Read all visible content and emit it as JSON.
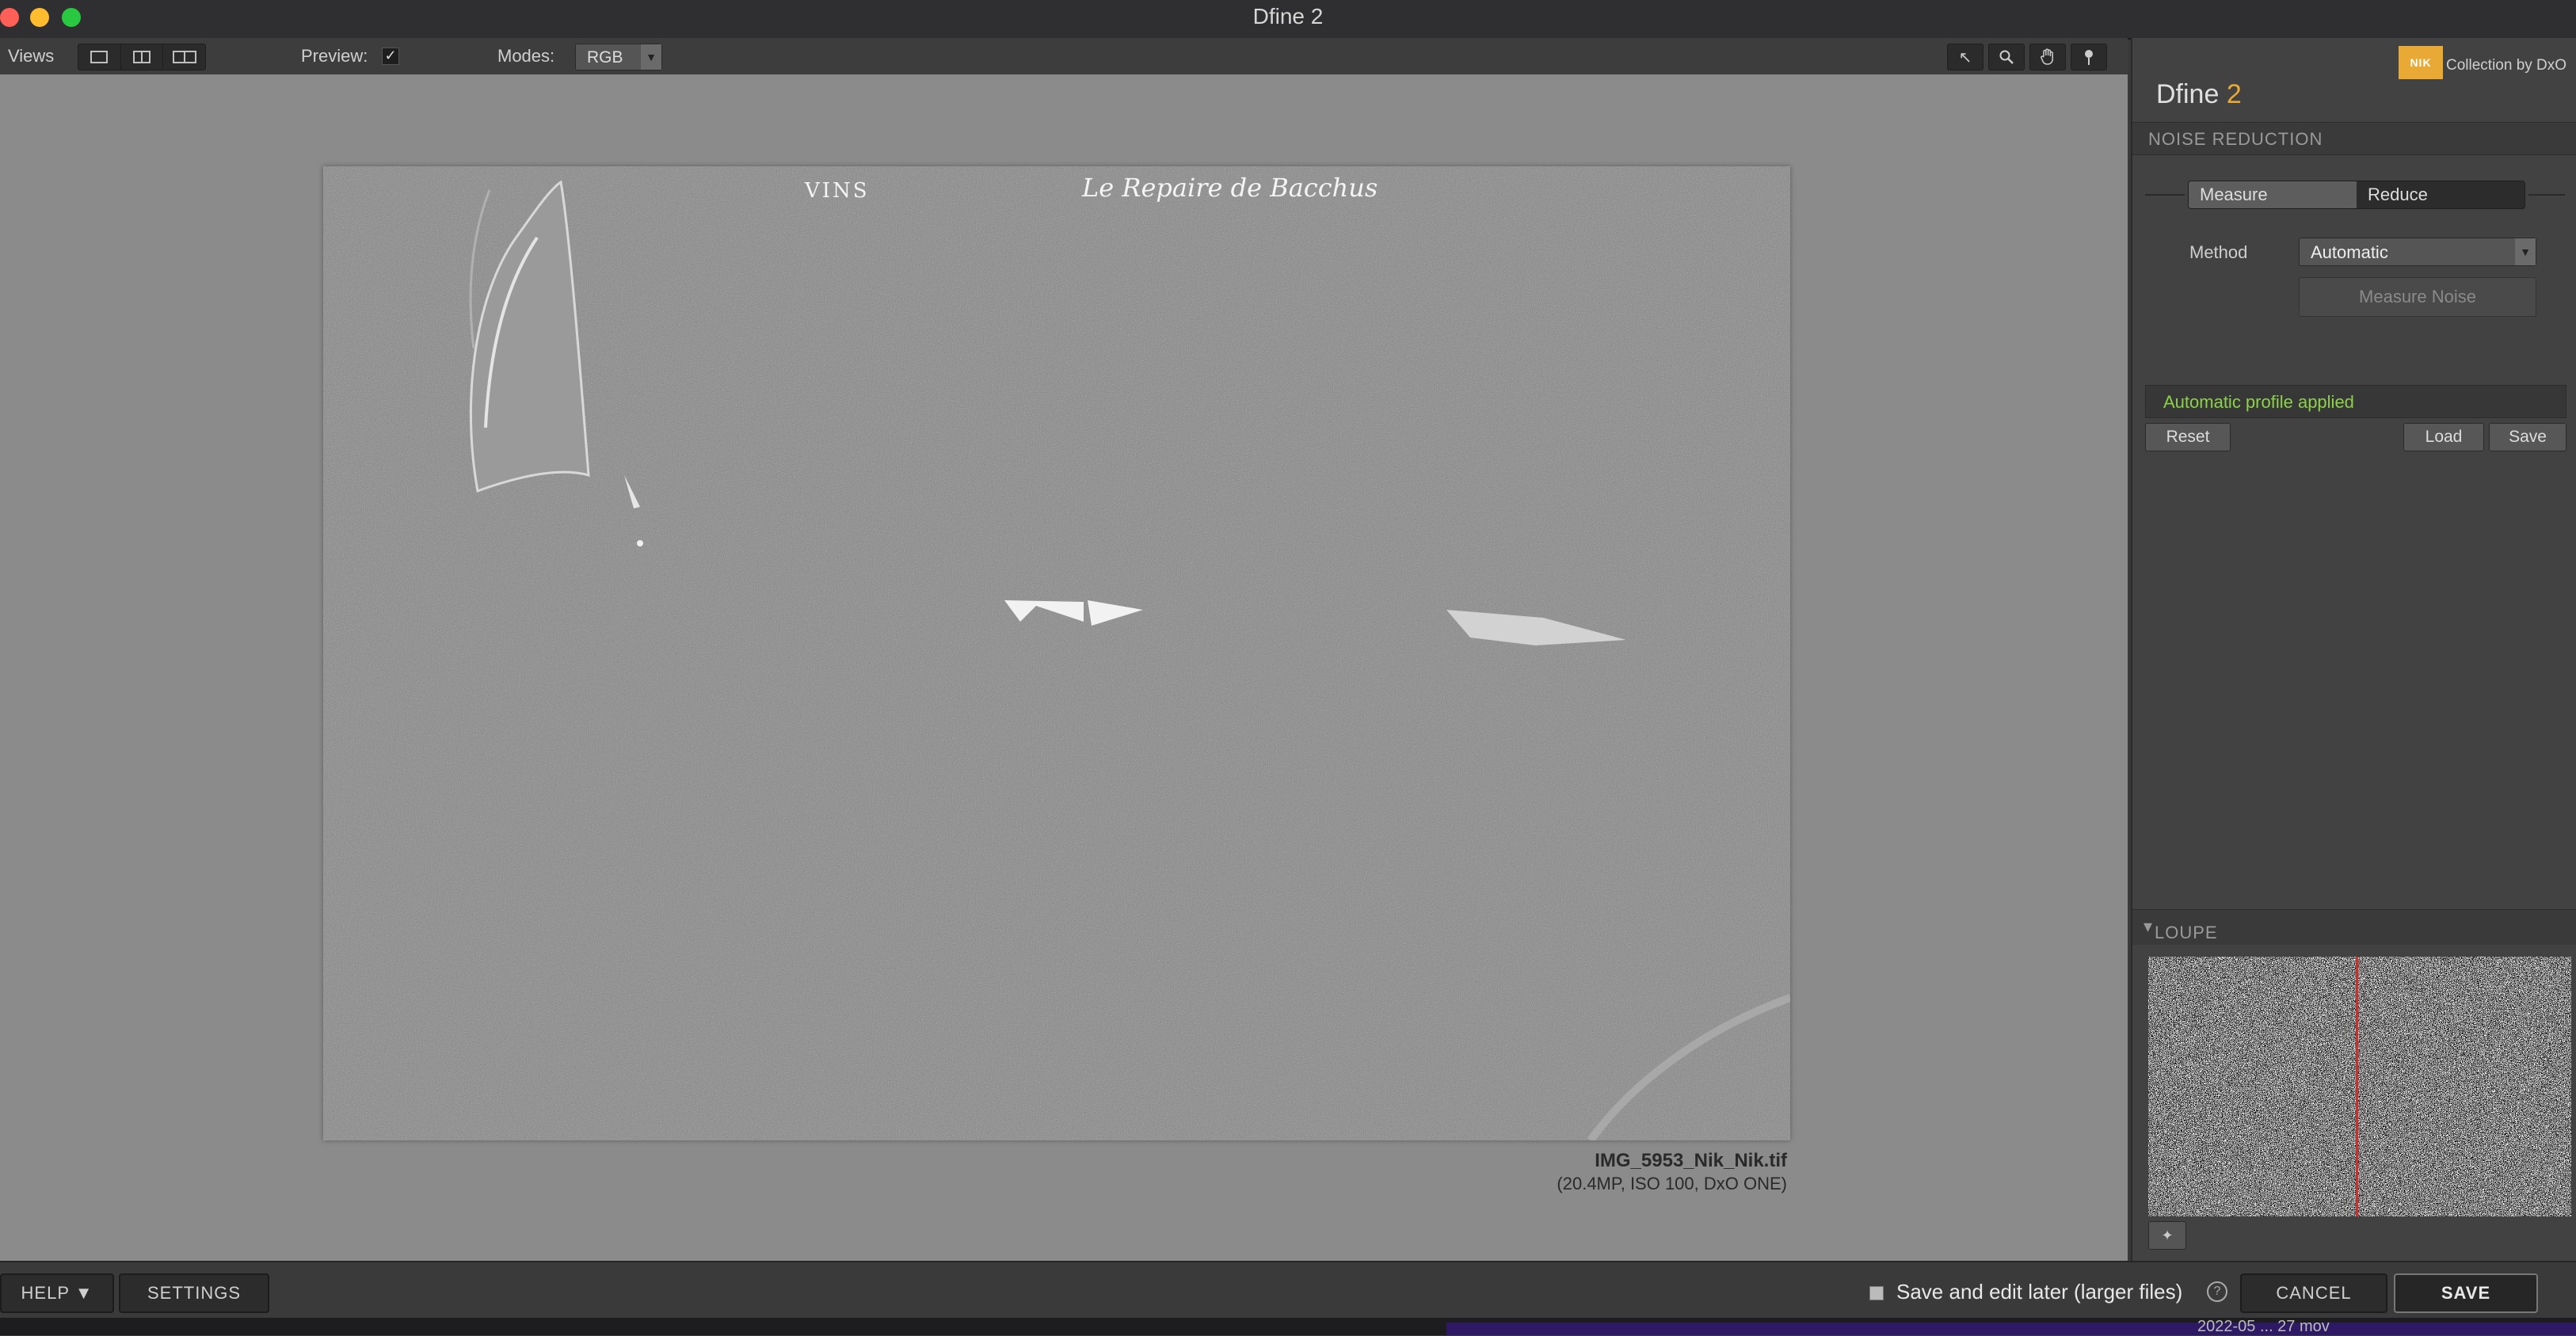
{
  "window": {
    "title": "Dfine 2"
  },
  "toolbar": {
    "views_label": "Views",
    "preview_label": "Preview:",
    "preview_checked": "✓",
    "modes_label": "Modes:",
    "modes_value": "RGB"
  },
  "image": {
    "filename": "IMG_5953_Nik_Nik.tif",
    "meta": "(20.4MP, ISO 100, DxO ONE)",
    "text_vins": "VINS",
    "text_sign": "Le Repaire de Bacchus"
  },
  "panel": {
    "logo_text": "NIK",
    "collection_text": "Collection by DxO",
    "app_name": "Dfine",
    "app_version": "2",
    "section_title": "NOISE REDUCTION",
    "tabs": [
      {
        "label": "Measure"
      },
      {
        "label": "Reduce"
      }
    ],
    "method_label": "Method",
    "method_value": "Automatic",
    "measure_button": "Measure Noise",
    "status": "Automatic profile applied",
    "reset_button": "Reset",
    "load_button": "Load",
    "save_button": "Save",
    "loupe_title": "LOUPE"
  },
  "bottom": {
    "help_button": "HELP ▼",
    "settings_button": "SETTINGS",
    "save_later_label": "Save and edit later (larger files)",
    "cancel_button": "CANCEL",
    "save_button": "SAVE"
  },
  "desktop": {
    "text": "2022-05 ... 27 mov"
  },
  "colors": {
    "accent": "#e9a935",
    "status_green": "#8bd14a",
    "loupe_line": "#c8322e"
  }
}
